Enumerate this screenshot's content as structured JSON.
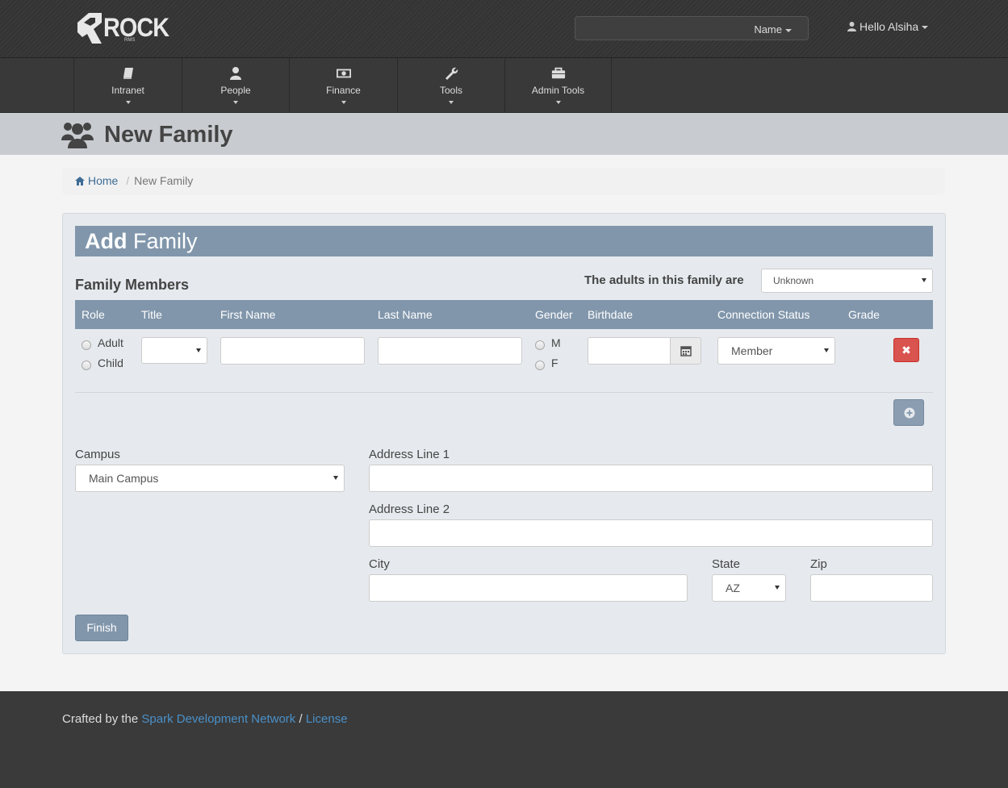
{
  "header": {
    "logo_text": "ROCK",
    "logo_sub": "RMS",
    "search_scope": "Name",
    "user_greeting": "Hello Alsiha"
  },
  "nav": {
    "items": [
      {
        "label": "Intranet",
        "icon": "book-icon"
      },
      {
        "label": "People",
        "icon": "person-icon"
      },
      {
        "label": "Finance",
        "icon": "money-icon"
      },
      {
        "label": "Tools",
        "icon": "wrench-icon"
      },
      {
        "label": "Admin Tools",
        "icon": "briefcase-icon"
      }
    ]
  },
  "page": {
    "title": "New Family"
  },
  "breadcrumb": {
    "home": "Home",
    "current": "New Family"
  },
  "panel": {
    "title_bold": "Add",
    "title_light": "Family",
    "family_members_title": "Family Members",
    "adults_label": "The adults in this family are",
    "adults_value": "Unknown",
    "columns": [
      "Role",
      "Title",
      "First Name",
      "Last Name",
      "Gender",
      "Birthdate",
      "Connection Status",
      "Grade"
    ],
    "row": {
      "role_options": [
        "Adult",
        "Child"
      ],
      "title_value": "",
      "first_name": "",
      "last_name": "",
      "gender_options": [
        "M",
        "F"
      ],
      "birthdate": "",
      "connection_status": "Member",
      "grade": ""
    },
    "delete_symbol": "✖",
    "campus_label": "Campus",
    "campus_value": "Main Campus",
    "address1_label": "Address Line 1",
    "address1_value": "",
    "address2_label": "Address Line 2",
    "address2_value": "",
    "city_label": "City",
    "city_value": "",
    "state_label": "State",
    "state_value": "AZ",
    "zip_label": "Zip",
    "zip_value": "",
    "finish_label": "Finish"
  },
  "footer": {
    "prefix": "Crafted by the",
    "org_link": "Spark Development Network",
    "separator": "/",
    "license_link": "License"
  },
  "colors": {
    "accent": "#8196ab",
    "link": "#3d6c95",
    "danger": "#d9534f",
    "header_bg": "#353535"
  }
}
